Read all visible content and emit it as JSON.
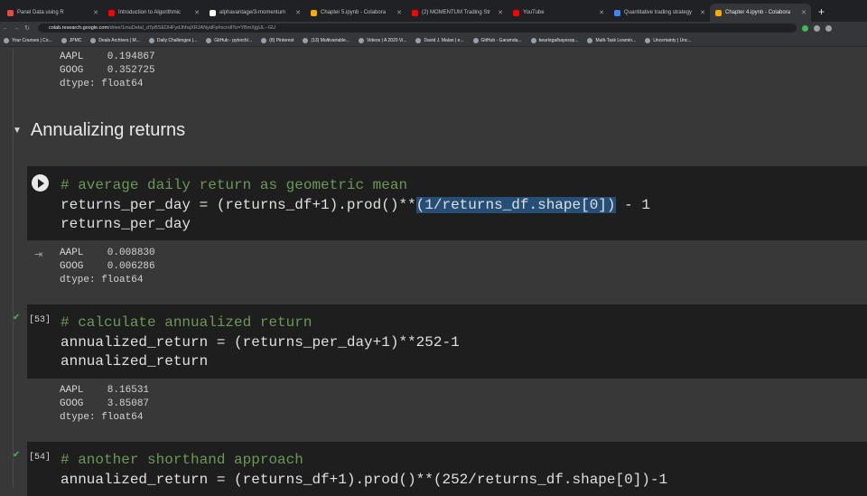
{
  "tabs": [
    {
      "title": "Panel Data using R",
      "color": "#e44"
    },
    {
      "title": "Introduction to Algorithmic",
      "color": "#f00"
    },
    {
      "title": "alphavantage/3-momentum",
      "color": "#fff"
    },
    {
      "title": "Chapter 5.ipynb - Colabora",
      "color": "#f9ab00"
    },
    {
      "title": "(2) MOMENTUM Trading Str",
      "color": "#f00"
    },
    {
      "title": "YouTube",
      "color": "#f00"
    },
    {
      "title": "Quantitative trading strategy",
      "color": "#4285f4"
    },
    {
      "title": "Chapter 4.ipynb - Colabora",
      "color": "#f9ab00",
      "active": true
    }
  ],
  "address": {
    "host": "colab.research.google.com",
    "path": "/drive/1muDeIaI_d7pBSEDHFydJhhqXRJANydFp#scrollTo=YBmXjgUL--GU"
  },
  "bookmarks": [
    "Your Courses | Co...",
    "JPMC",
    "Deals Archives | M...",
    "Daily Challenges |...",
    "GitHub - pytorch/...",
    "(8) Pinterest",
    "(13) Multivariable...",
    "Videos | A 2020 Vi...",
    "David J. Malan | e...",
    "GitHub - Garamda...",
    "bearloga/bayesop...",
    "Multi-Task Learnin...",
    "Uncertainty | Unc..."
  ],
  "prev_output": {
    "line1": "AAPL    0.194867",
    "line2": "GOOG    0.352725",
    "line3": "dtype: float64"
  },
  "section_title": "Annualizing returns",
  "cell1": {
    "comment": "# average daily return as geometric mean",
    "line2_a": "returns_per_day = (returns_df+1).prod()**",
    "line2_sel": "(1/returns_df.shape[0])",
    "line2_b": " - 1",
    "line3": "returns_per_day",
    "out1": "AAPL    0.008830",
    "out2": "GOOG    0.006286",
    "out3": "dtype: float64"
  },
  "cell2": {
    "exec": "[53]",
    "comment": "# calculate annualized return",
    "line2": "annualized_return = (returns_per_day+1)**252-1",
    "line3": "annualized_return",
    "out1": "AAPL    8.16531",
    "out2": "GOOG    3.85087",
    "out3": "dtype: float64"
  },
  "cell3": {
    "exec": "[54]",
    "comment": "# another shorthand approach",
    "line2": "annualized_return = (returns_df+1).prod()**(252/returns_df.shape[0])-1"
  }
}
